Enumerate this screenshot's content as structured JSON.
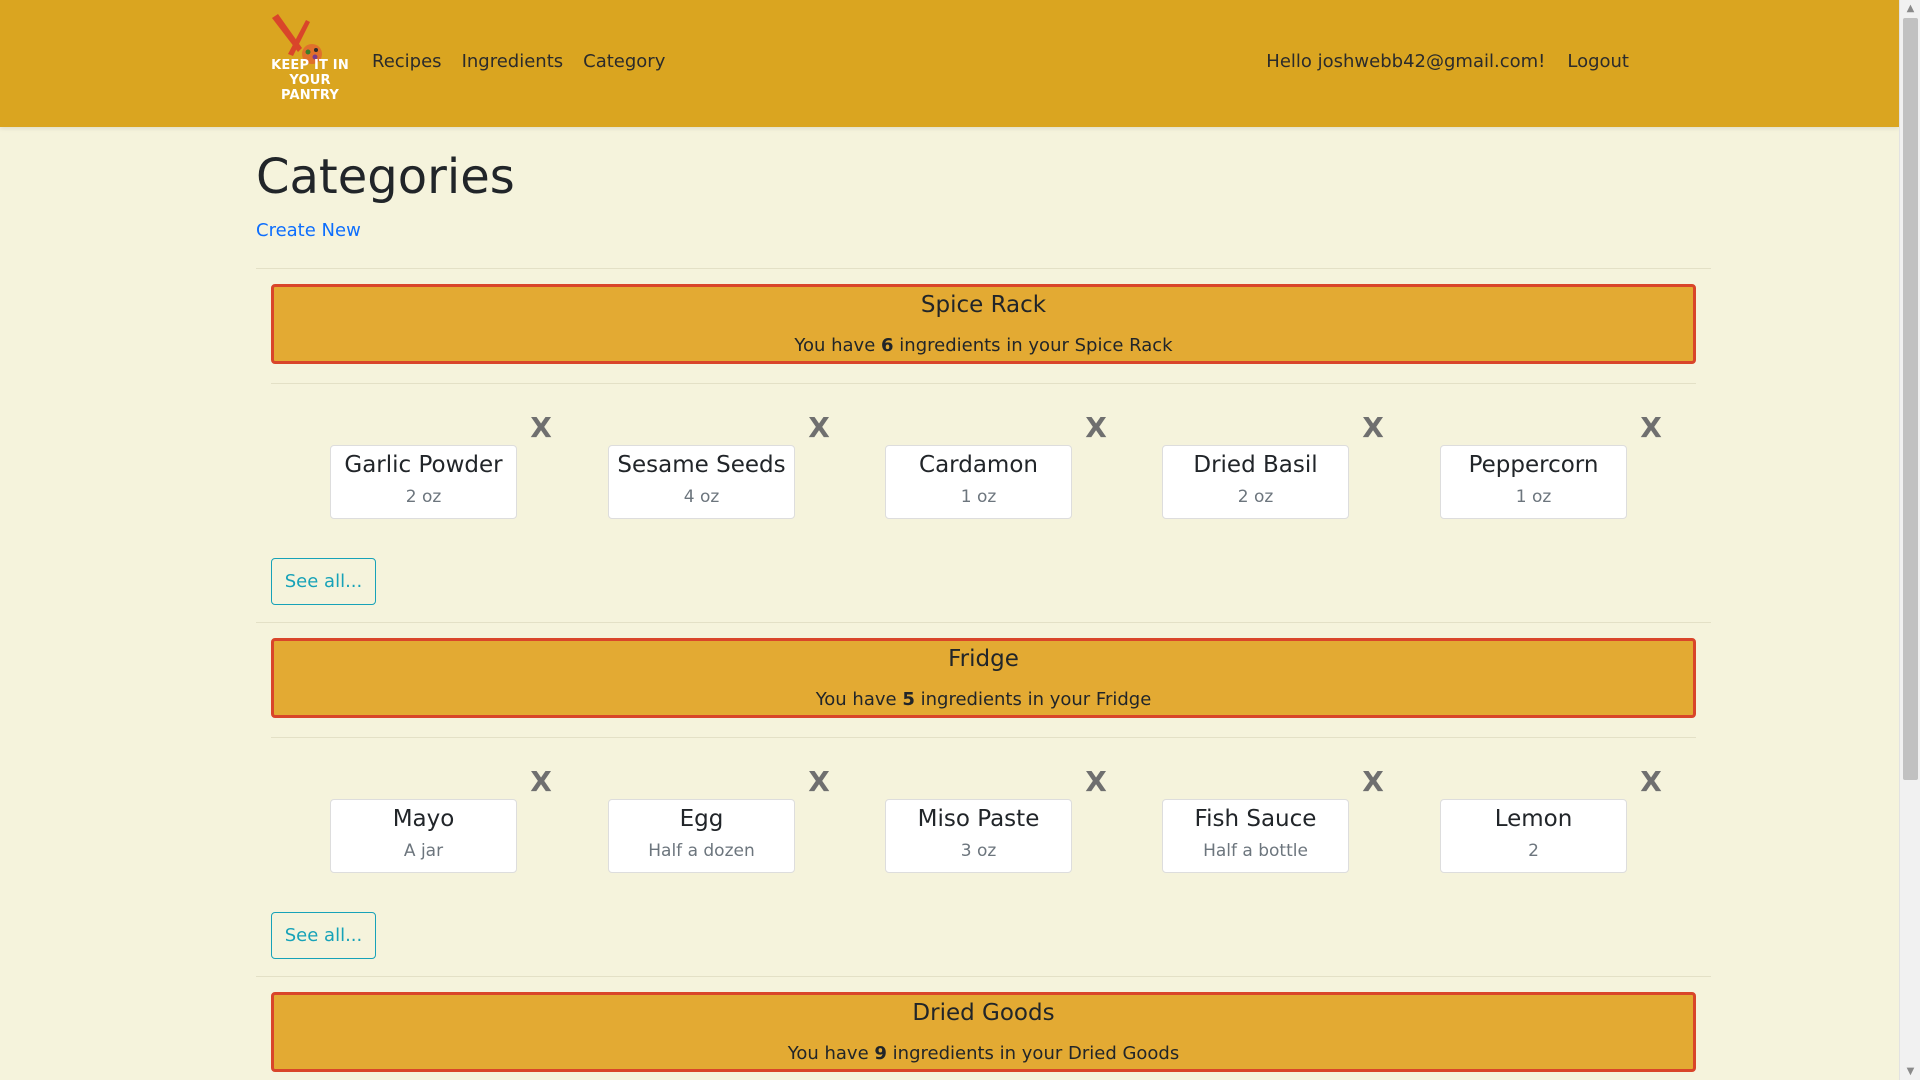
{
  "nav": {
    "brand_line1": "KEEP IT IN",
    "brand_line2": "YOUR PANTRY",
    "links": [
      "Recipes",
      "Ingredients",
      "Category"
    ],
    "greeting": "Hello joshwebb42@gmail.com!",
    "logout": "Logout"
  },
  "page": {
    "title": "Categories",
    "create_new": "Create New"
  },
  "categories": [
    {
      "name": "Spice Rack",
      "count_prefix": "You have",
      "count": "6",
      "count_suffix": "ingredients in your Spice Rack",
      "ingredients": [
        {
          "name": "Garlic Powder",
          "qty": "2 oz"
        },
        {
          "name": "Sesame Seeds",
          "qty": "4 oz"
        },
        {
          "name": "Cardamon",
          "qty": "1 oz"
        },
        {
          "name": "Dried Basil",
          "qty": "2 oz"
        },
        {
          "name": "Peppercorn",
          "qty": "1 oz"
        }
      ],
      "see_all": "See all..."
    },
    {
      "name": "Fridge",
      "count_prefix": "You have",
      "count": "5",
      "count_suffix": "ingredients in your Fridge",
      "ingredients": [
        {
          "name": "Mayo",
          "qty": "A jar"
        },
        {
          "name": "Egg",
          "qty": "Half a dozen"
        },
        {
          "name": "Miso Paste",
          "qty": "3 oz"
        },
        {
          "name": "Fish Sauce",
          "qty": "Half a bottle"
        },
        {
          "name": "Lemon",
          "qty": "2"
        }
      ],
      "see_all": "See all..."
    },
    {
      "name": "Dried Goods",
      "count_prefix": "You have",
      "count": "9",
      "count_suffix": "ingredients in your Dried Goods"
    }
  ],
  "remove_label": "X",
  "colors": {
    "navbar": "#daa520",
    "background": "#f5f3dc",
    "category_fill": "#e3aa33",
    "category_border": "#d9452a",
    "link": "#0d6efd",
    "outline_button": "#17a2b8"
  },
  "icons": {
    "logo": "knife-and-fork-logo-icon",
    "remove": "remove-x-icon",
    "scroll_up": "scroll-up-arrow-icon",
    "scroll_down": "scroll-down-arrow-icon"
  }
}
